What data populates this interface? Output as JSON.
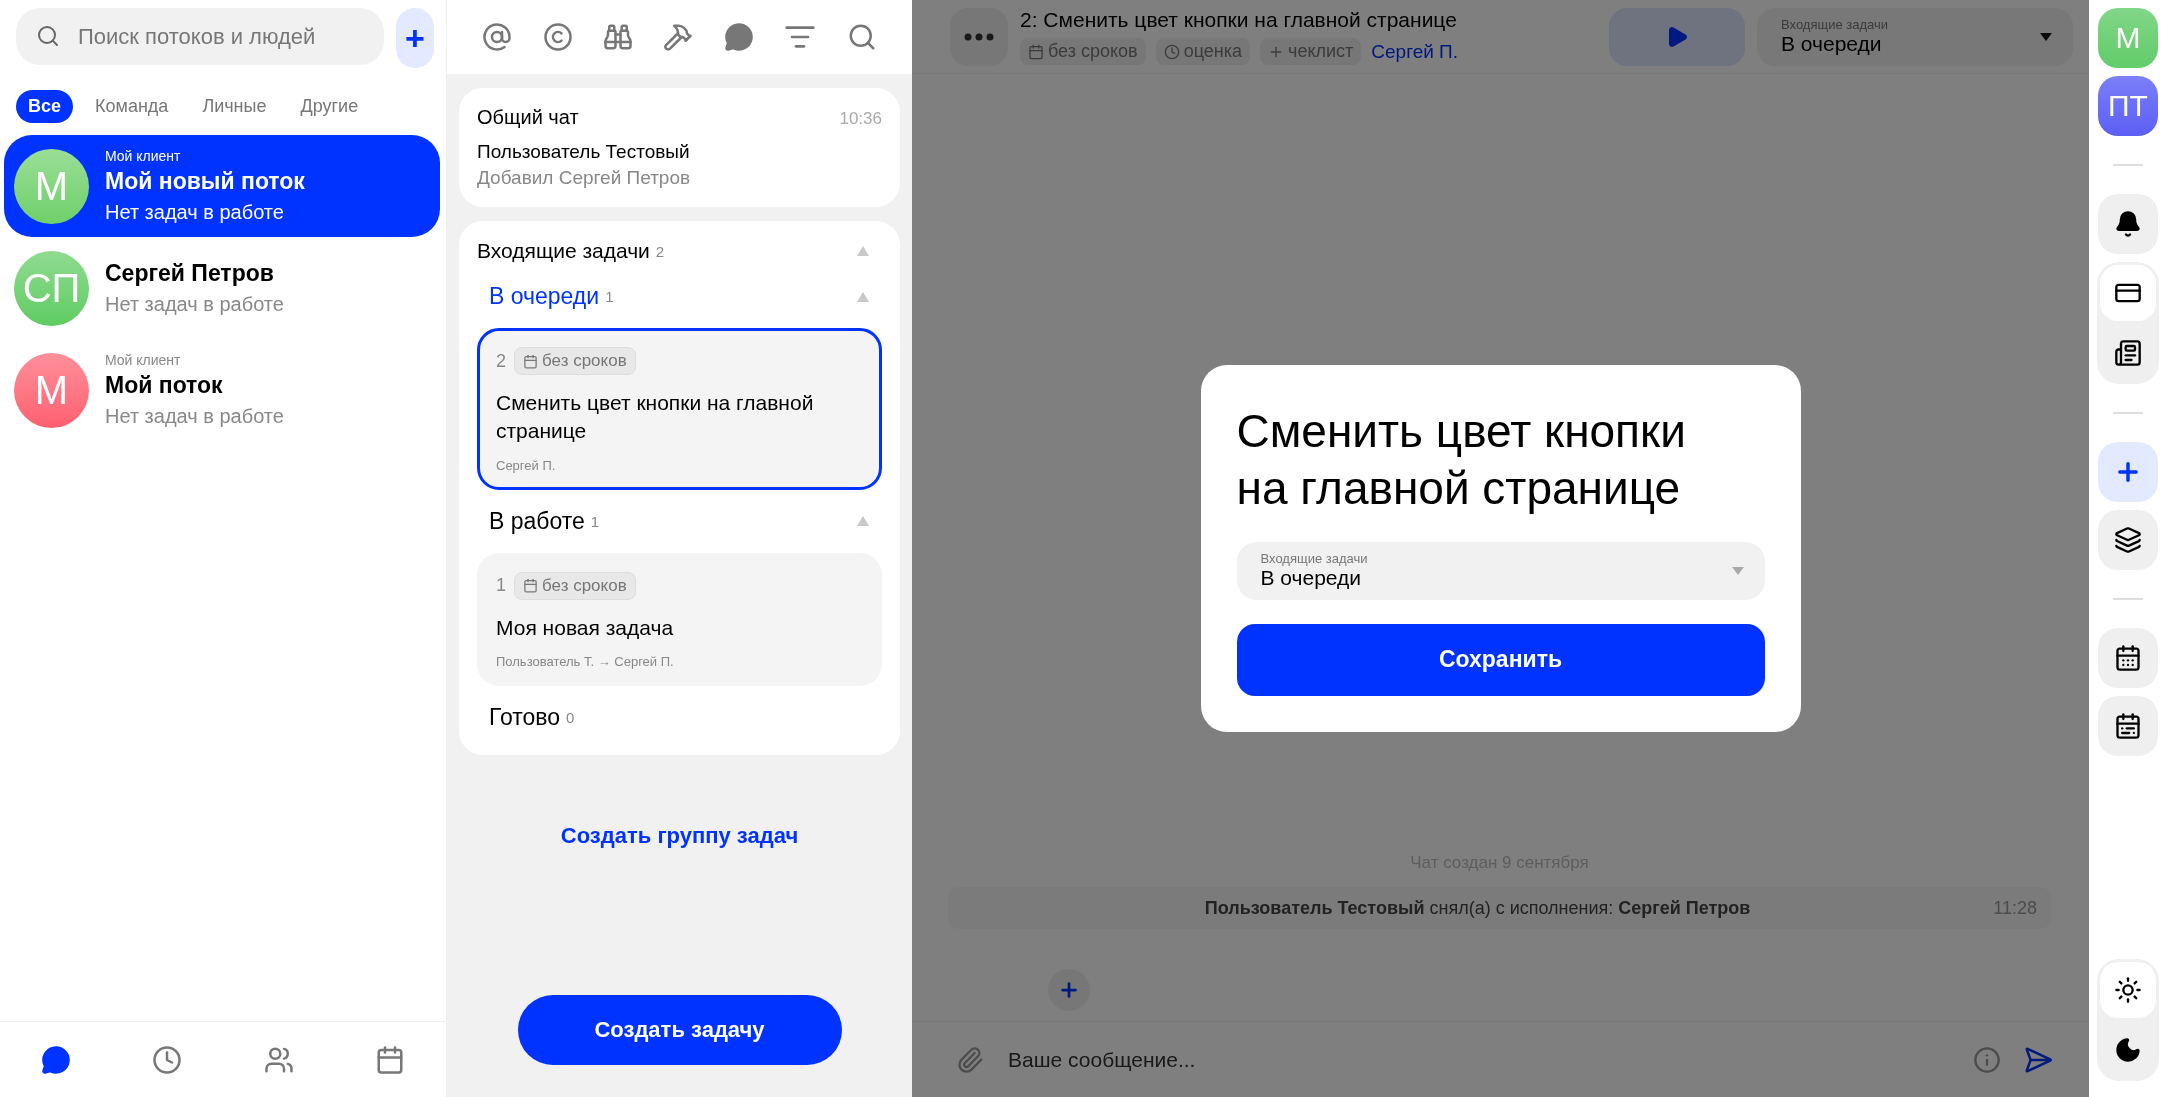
{
  "streams_panel": {
    "search": {
      "placeholder": "Поиск потоков и людей"
    },
    "add_button": "+",
    "filters": [
      {
        "label": "Все",
        "selected": true
      },
      {
        "label": "Команда",
        "selected": false
      },
      {
        "label": "Личные",
        "selected": false
      },
      {
        "label": "Другие",
        "selected": false
      }
    ],
    "streams": [
      {
        "initials": "М",
        "color": "#6fd06a",
        "tag": "Мой клиент",
        "name": "Мой новый поток",
        "status": "Нет задач в работе",
        "selected": true
      },
      {
        "initials": "СП",
        "color": "#5fcc62",
        "name": "Сергей Петров",
        "status": "Нет задач в работе",
        "selected": false
      },
      {
        "initials": "М",
        "color": "#ff6070",
        "tag": "Мой клиент",
        "name": "Мой поток",
        "status": "Нет задач в работе",
        "selected": false
      }
    ],
    "bottom_nav": [
      {
        "kind": "chats",
        "selected": true
      },
      {
        "kind": "history",
        "selected": false
      },
      {
        "kind": "people",
        "selected": false
      },
      {
        "kind": "calendar",
        "selected": false
      }
    ]
  },
  "tasks_panel": {
    "chat_card": {
      "title": "Общий чат",
      "time": "10:36",
      "line_1": "Пользователь Тестовый",
      "line_2": "Добавил Сергей Петров"
    },
    "group": {
      "title": "Входящие задачи",
      "count": "2",
      "expanded": true,
      "sections": [
        {
          "title": "В очереди",
          "count": "1",
          "selected": true,
          "expanded": true,
          "tasks": [
            {
              "number": "2",
              "deadline": "без сроков",
              "title": "Сменить цвет кнопки на главной странице",
              "people": "Сергей П.",
              "selected": true
            }
          ]
        },
        {
          "title": "В работе",
          "count": "1",
          "selected": false,
          "expanded": true,
          "tasks": [
            {
              "number": "1",
              "deadline": "без сроков",
              "title": "Моя новая задача",
              "people": "Пользователь Т. → Сергей П.",
              "selected": false
            }
          ]
        },
        {
          "title": "Готово",
          "count": "0",
          "selected": false
        }
      ]
    },
    "create_group_link": "Создать группу задач",
    "create_task_button": "Создать задачу"
  },
  "chat": {
    "header": {
      "title": "2: Сменить цвет кнопки на главной странице",
      "chips": [
        {
          "kind": "deadline",
          "label": "без сроков"
        },
        {
          "kind": "estimate",
          "label": "оценка"
        },
        {
          "kind": "checklist",
          "label": "чеклист"
        }
      ],
      "assignee": "Сергей П.",
      "status": {
        "label": "Входящие задачи",
        "value": "В очереди"
      }
    },
    "date_note": "Чат создан 9 сентября",
    "events": [
      {
        "text": "**Пользователь Тестовый** снял(а) с исполнения: **Сергей Петров**",
        "time": "11:28"
      }
    ],
    "composer": {
      "placeholder": "Ваше сообщение..."
    }
  },
  "modal": {
    "title": "Сменить цвет кнопки на главной странице",
    "select": {
      "label": "Входящие задачи",
      "value": "В очереди"
    },
    "save_button": "Сохранить"
  },
  "right_bar": {
    "workspaces": [
      {
        "initials": "М",
        "color": "#62cc6a"
      },
      {
        "initials": "ПТ",
        "color": "#5b5ff5"
      }
    ],
    "views": [
      {
        "kind": "board",
        "selected": true
      },
      {
        "kind": "list",
        "selected": false
      }
    ],
    "theme": [
      {
        "kind": "light",
        "selected": true
      },
      {
        "kind": "dark",
        "selected": false
      }
    ]
  }
}
